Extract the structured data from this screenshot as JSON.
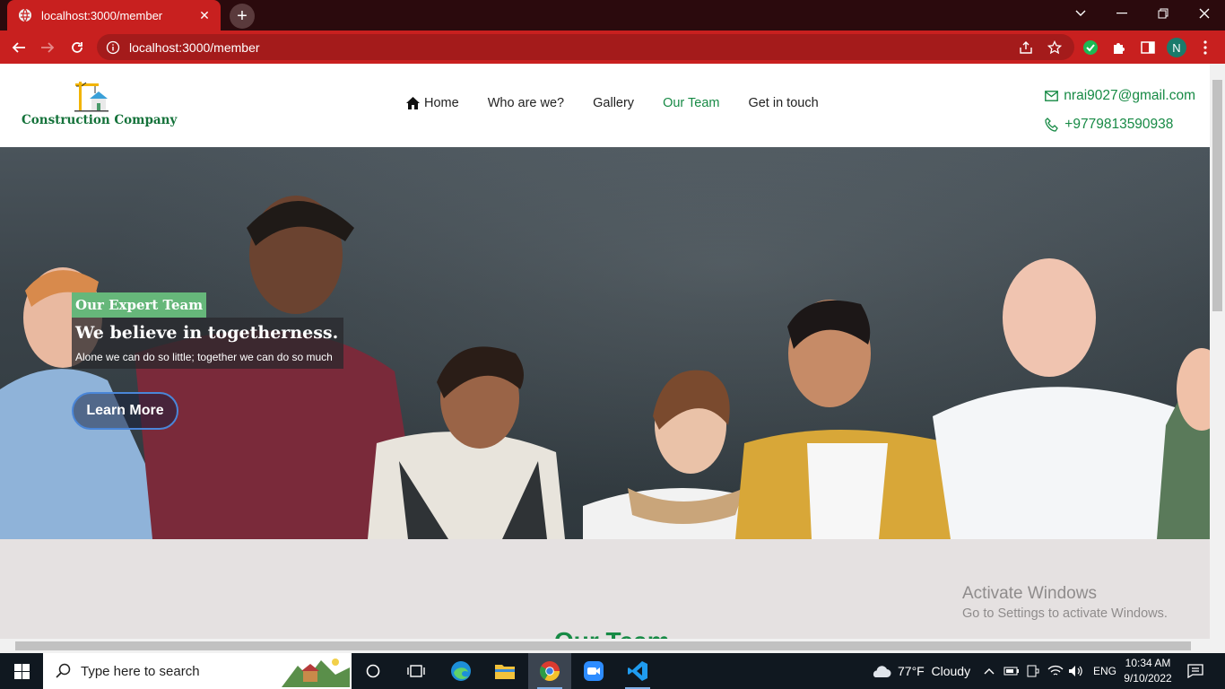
{
  "browser": {
    "tab_title": "localhost:3000/member",
    "url": "localhost:3000/member",
    "profile_initial": "N"
  },
  "site": {
    "logo_text": "Construction Company",
    "nav": [
      {
        "label": "Home"
      },
      {
        "label": "Who are we?"
      },
      {
        "label": "Gallery"
      },
      {
        "label": "Our Team"
      },
      {
        "label": "Get in touch"
      }
    ],
    "contact": {
      "email": "nrai9027@gmail.com",
      "phone": "+9779813590938"
    },
    "hero": {
      "badge": "Our Expert Team",
      "headline": "We believe in togetherness.",
      "subline": "Alone we can do so little; together we can do so much",
      "cta": "Learn More"
    },
    "section_title": "Our Team"
  },
  "watermark": {
    "title": "Activate Windows",
    "subtitle": "Go to Settings to activate Windows."
  },
  "taskbar": {
    "search_placeholder": "Type here to search",
    "weather": "77°F  Cloudy",
    "language": "ENG",
    "time": "10:34 AM",
    "date": "9/10/2022"
  },
  "colors": {
    "chrome_red": "#c8201f",
    "brand_green": "#178a45",
    "badge_green": "#66b77a"
  }
}
